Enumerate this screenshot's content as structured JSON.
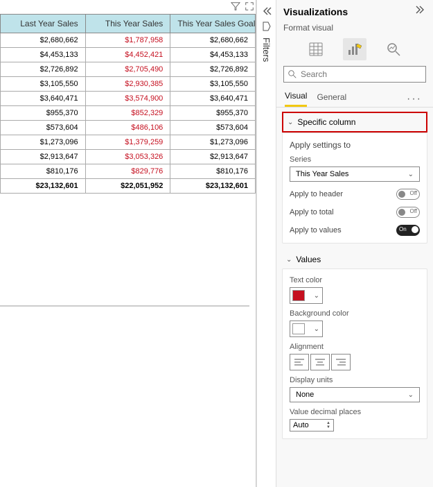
{
  "table": {
    "columns": [
      "Last Year Sales",
      "This Year Sales",
      "This Year Sales Goal"
    ],
    "rows": [
      [
        "$2,680,662",
        "$1,787,958",
        "$2,680,662"
      ],
      [
        "$4,453,133",
        "$4,452,421",
        "$4,453,133"
      ],
      [
        "$2,726,892",
        "$2,705,490",
        "$2,726,892"
      ],
      [
        "$3,105,550",
        "$2,930,385",
        "$3,105,550"
      ],
      [
        "$3,640,471",
        "$3,574,900",
        "$3,640,471"
      ],
      [
        "$955,370",
        "$852,329",
        "$955,370"
      ],
      [
        "$573,604",
        "$486,106",
        "$573,604"
      ],
      [
        "$1,273,096",
        "$1,379,259",
        "$1,273,096"
      ],
      [
        "$2,913,647",
        "$3,053,326",
        "$2,913,647"
      ],
      [
        "$810,176",
        "$829,776",
        "$810,176"
      ]
    ],
    "total": [
      "$23,132,601",
      "$22,051,952",
      "$23,132,601"
    ],
    "red_cols": [
      1
    ]
  },
  "filters_label": "Filters",
  "viz": {
    "title": "Visualizations",
    "subtitle": "Format visual",
    "search_placeholder": "Search",
    "tabs": {
      "visual": "Visual",
      "general": "General"
    },
    "section": "Specific column",
    "apply_to_title": "Apply settings to",
    "series_label": "Series",
    "series_value": "This Year Sales",
    "apply_header": "Apply to header",
    "apply_total": "Apply to total",
    "apply_values": "Apply to values",
    "values_section": "Values",
    "text_color_label": "Text color",
    "text_color": "#c50f1f",
    "bg_color_label": "Background color",
    "bg_color": "#ffffff",
    "alignment_label": "Alignment",
    "display_units_label": "Display units",
    "display_units_value": "None",
    "decimal_label": "Value decimal places",
    "decimal_value": "Auto"
  }
}
